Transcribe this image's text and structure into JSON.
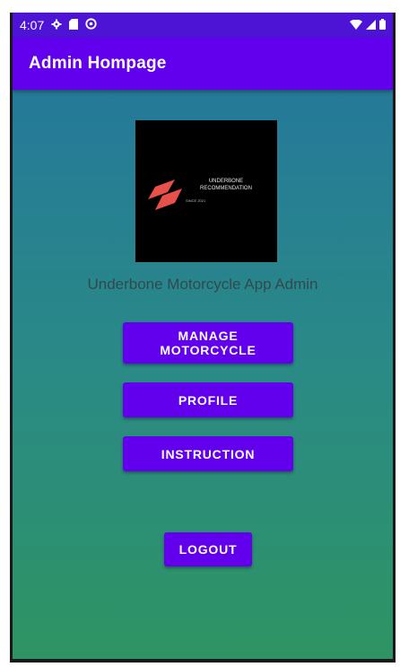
{
  "status_bar": {
    "time": "4:07",
    "icons_left": [
      "gear-icon",
      "sd-card-icon",
      "sync-icon"
    ],
    "icons_right": [
      "wifi-icon",
      "signal-icon",
      "battery-icon"
    ]
  },
  "app_bar": {
    "title": "Admin Hompage"
  },
  "logo": {
    "line1": "UNDERBONE",
    "line2": "RECOMMENDATION",
    "since": "SINCE 2021",
    "accent_color": "#e8504a"
  },
  "caption": "Underbone Motorcycle App Admin",
  "buttons": {
    "manage_line1": "MANAGE",
    "manage_line2": "MOTORCYCLE",
    "profile": "PROFILE",
    "instruction": "INSTRUCTION",
    "logout": "LOGOUT"
  },
  "colors": {
    "primary": "#6200ee",
    "status_bar": "#4e14d6"
  }
}
